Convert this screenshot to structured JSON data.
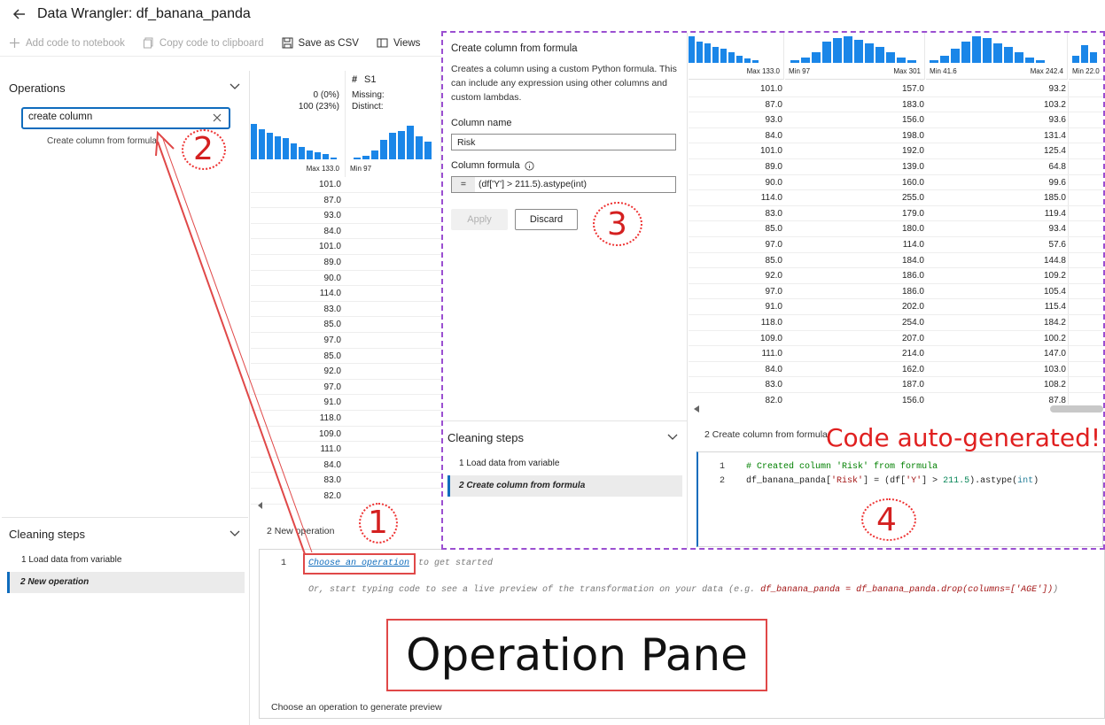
{
  "titlebar": {
    "title": "Data Wrangler: df_banana_panda"
  },
  "toolbar": {
    "add_code": "Add code to notebook",
    "copy_code": "Copy code to clipboard",
    "save_csv": "Save as CSV",
    "views": "Views"
  },
  "operations": {
    "title": "Operations",
    "search_value": "create column",
    "result": "Create column from formula"
  },
  "cleaning_steps": {
    "title": "Cleaning steps",
    "steps": [
      "1  Load data from variable",
      "2  New operation"
    ]
  },
  "grid": {
    "col1": {
      "missing": "0 (0%)",
      "distinct": "100 (23%)",
      "max": "Max 133.0"
    },
    "col2": {
      "name": "S1",
      "missing_label": "Missing:",
      "distinct_label": "Distinct:",
      "min": "Min 97"
    },
    "values": [
      "101.0",
      "87.0",
      "93.0",
      "84.0",
      "101.0",
      "89.0",
      "90.0",
      "114.0",
      "83.0",
      "85.0",
      "97.0",
      "85.0",
      "92.0",
      "97.0",
      "91.0",
      "118.0",
      "109.0",
      "111.0",
      "84.0",
      "83.0",
      "82.0"
    ]
  },
  "operation_pane": {
    "title": "2  New operation",
    "line_num": "1",
    "choose_link": "Choose an operation",
    "choose_rest": "to get started",
    "hint_prefix": "Or, start typing code to see a live preview of the transformation on your data (e.g.",
    "hint_code": "df_banana_panda = df_banana_panda.drop(columns=['AGE'])",
    "hint_suffix": ")",
    "preview_note": "Choose an operation to generate preview"
  },
  "formula_panel": {
    "title": "Create column from formula",
    "description": "Creates a column using a custom Python formula. This can include any expression using other columns and custom lambdas.",
    "column_name_label": "Column name",
    "column_name_value": "Risk",
    "formula_label": "Column formula",
    "formula_prefix": "=",
    "formula_value": "(df['Y'] > 211.5).astype(int)",
    "apply": "Apply",
    "discard": "Discard",
    "cleaning_title": "Cleaning steps",
    "steps": [
      "1  Load data from variable",
      "2  Create column from formula"
    ],
    "op_title": "2  Create column from formula"
  },
  "overlay_grid": {
    "headers": [
      {
        "right": "Max 133.0"
      },
      {
        "left": "Min 97",
        "right": "Max 301"
      },
      {
        "left": "Min 41.6",
        "right": "Max 242.4"
      },
      {
        "left": "Min 22.0"
      }
    ],
    "rows": [
      [
        "101.0",
        "157.0",
        "93.2"
      ],
      [
        "87.0",
        "183.0",
        "103.2"
      ],
      [
        "93.0",
        "156.0",
        "93.6"
      ],
      [
        "84.0",
        "198.0",
        "131.4"
      ],
      [
        "101.0",
        "192.0",
        "125.4"
      ],
      [
        "89.0",
        "139.0",
        "64.8"
      ],
      [
        "90.0",
        "160.0",
        "99.6"
      ],
      [
        "114.0",
        "255.0",
        "185.0"
      ],
      [
        "83.0",
        "179.0",
        "119.4"
      ],
      [
        "85.0",
        "180.0",
        "93.4"
      ],
      [
        "97.0",
        "114.0",
        "57.6"
      ],
      [
        "85.0",
        "184.0",
        "144.8"
      ],
      [
        "92.0",
        "186.0",
        "109.2"
      ],
      [
        "97.0",
        "186.0",
        "105.4"
      ],
      [
        "91.0",
        "202.0",
        "115.4"
      ],
      [
        "118.0",
        "254.0",
        "184.2"
      ],
      [
        "109.0",
        "207.0",
        "100.2"
      ],
      [
        "111.0",
        "214.0",
        "147.0"
      ],
      [
        "84.0",
        "162.0",
        "103.0"
      ],
      [
        "83.0",
        "187.0",
        "108.2"
      ],
      [
        "82.0",
        "156.0",
        "87.8"
      ]
    ]
  },
  "generated_code": {
    "ln1": "1",
    "ln2": "2",
    "comment": "# Created column 'Risk' from formula",
    "code_a": "df_banana_panda[",
    "code_str1": "'Risk'",
    "code_b": "] = (df[",
    "code_str2": "'Y'",
    "code_c": "] > ",
    "code_num": "211.5",
    "code_d": ").astype(",
    "code_builtin": "int",
    "code_e": ")"
  },
  "annotations": {
    "n1": "1",
    "n2": "2",
    "n3": "3",
    "n4": "4",
    "operation_pane_label": "Operation Pane",
    "code_auto": "Code auto-generated!"
  },
  "colors": {
    "accent": "#0f6cbd",
    "histogram": "#1a86e8",
    "annotation_red": "#d42020",
    "overlay_border": "#9b4fd1"
  }
}
